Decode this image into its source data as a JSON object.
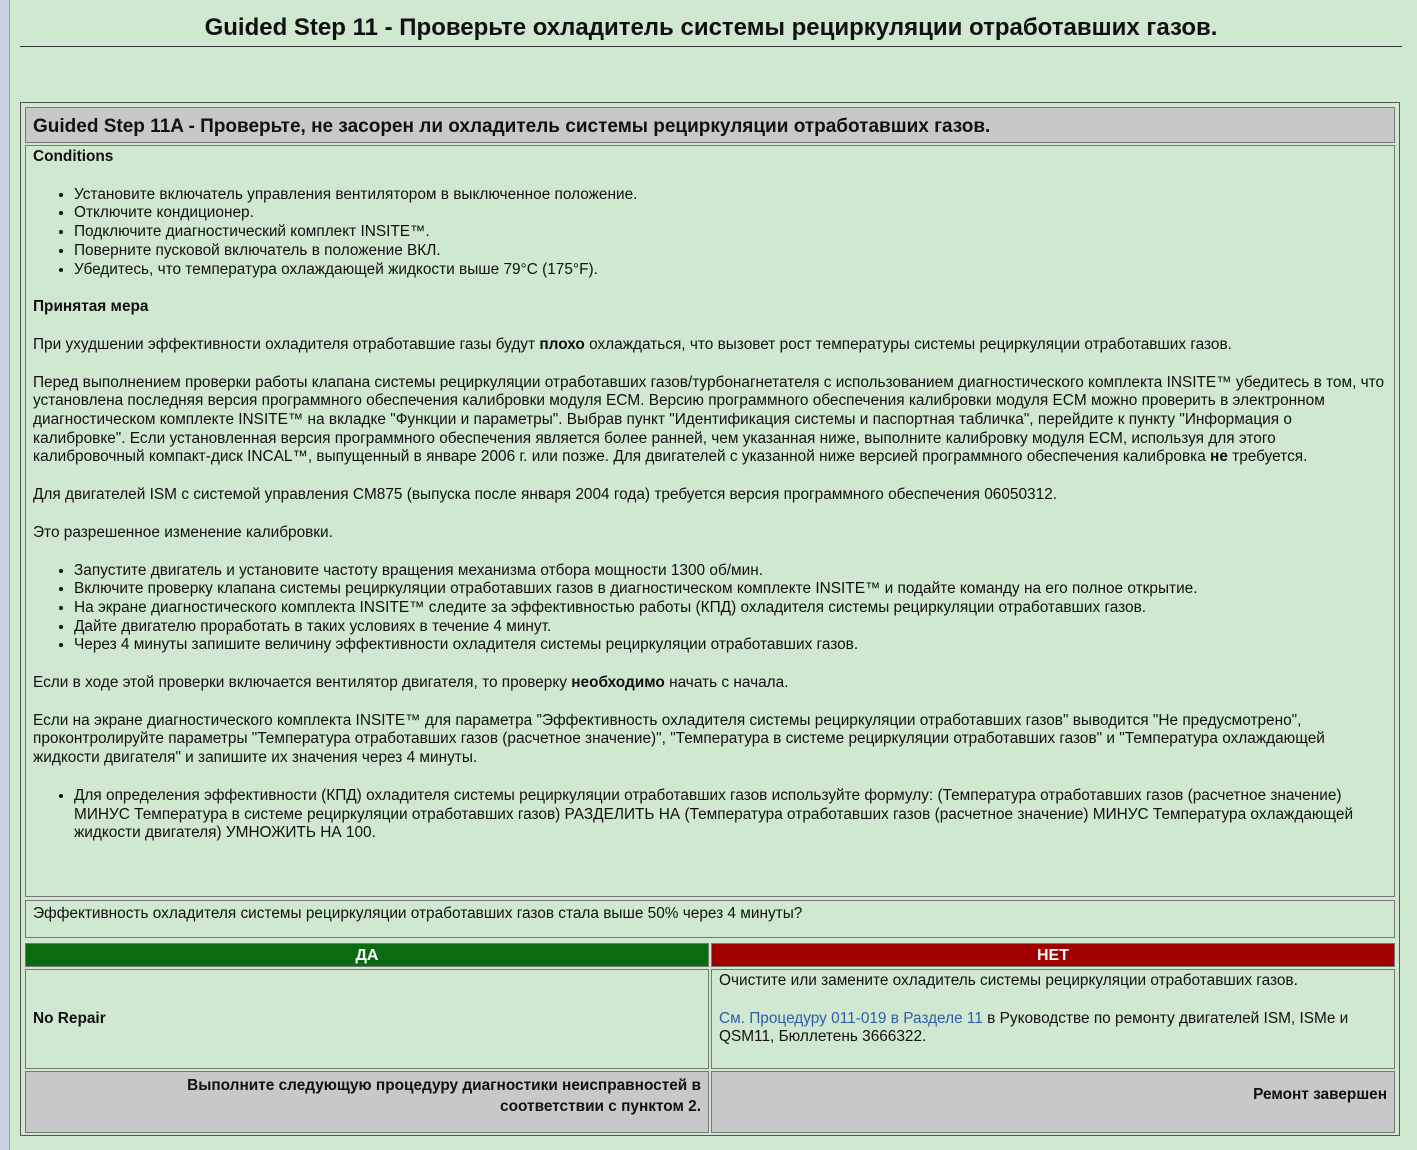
{
  "page": {
    "title": "Guided Step 11 - Проверьте охладитель системы рециркуляции отработавших газов."
  },
  "substep": {
    "title": "Guided Step 11A - Проверьте, не засорен ли охладитель системы рециркуляции отработавших газов."
  },
  "conditions": {
    "label": "Conditions",
    "items": [
      "Установите включатель управления вентилятором в выключенное положение.",
      "Отключите кондиционер.",
      "Подключите диагностический комплект INSITE™.",
      "Поверните пусковой включатель в положение ВКЛ.",
      "Убедитесь, что температура охлаждающей жидкости выше 79°C (175°F)."
    ]
  },
  "action": {
    "label": "Принятая мера",
    "p1_before": "При ухудшении эффективности охладителя отработавшие газы будут ",
    "p1_bold": "плохо",
    "p1_after": " охлаждаться, что вызовет рост температуры системы рециркуляции отработавших газов.",
    "p2_before": "Перед выполнением проверки работы клапана системы рециркуляции отработавших газов/турбонагнетателя с использованием диагностического комплекта INSITE™ убедитесь в том, что установлена последняя версия программного обеспечения калибровки модуля ECM. Версию программного обеспечения калибровки модуля ECM можно проверить в электронном диагностическом комплекте INSITE™ на вкладке \"Функции и параметры\". Выбрав пункт \"Идентификация системы и паспортная табличка\", перейдите к пункту \"Информация о калибровке\". Если установленная версия программного обеспечения является более ранней, чем указанная ниже, выполните калибровку модуля ECM, используя для этого калибровочный компакт-диск INCAL™, выпущенный в январе 2006 г. или позже. Для двигателей с указанной ниже версией программного обеспечения калибровка ",
    "p2_bold": "не",
    "p2_after": " требуется.",
    "p3": "Для двигателей ISM с системой управления CM875 (выпуска после января 2004 года) требуется версия программного обеспечения 06050312.",
    "p4": "Это разрешенное изменение калибровки.",
    "steps": [
      "Запустите двигатель и установите частоту вращения механизма отбора мощности 1300 об/мин.",
      "Включите проверку клапана системы рециркуляции отработавших газов в диагностическом комплекте INSITE™ и подайте команду на его полное открытие.",
      "На экране диагностического комплекта INSITE™ следите за эффективностью работы (КПД) охладителя системы рециркуляции отработавших газов.",
      "Дайте двигателю проработать в таких условиях в течение 4 минут.",
      "Через 4 минуты запишите величину эффективности охладителя системы рециркуляции отработавших газов."
    ],
    "p5_before": "Если в ходе этой проверки включается вентилятор двигателя, то проверку ",
    "p5_bold": "необходимо",
    "p5_after": " начать с начала.",
    "p6": "Если на экране диагностического комплекта INSITE™ для параметра \"Эффективность охладителя системы рециркуляции отработавших газов\" выводится \"Не предусмотрено\", проконтролируйте параметры \"Температура отработавших газов (расчетное значение)\", \"Температура в системе рециркуляции отработавших газов\" и \"Температура охлаждающей жидкости двигателя\" и запишите их значения через 4 минуты.",
    "formula": "Для определения эффективности (КПД) охладителя системы рециркуляции отработавших газов используйте формулу: (Температура отработавших газов (расчетное значение) МИНУС Температура в системе рециркуляции отработавших газов) РАЗДЕЛИТЬ НА (Температура отработавших газов (расчетное значение) МИНУС Температура охлаждающей жидкости двигателя) УМНОЖИТЬ НА 100."
  },
  "question": "Эффективность охладителя системы рециркуляции отработавших газов стала выше 50% через 4 минуты?",
  "yes": {
    "label": "ДА",
    "body": "No Repair",
    "footer": "Выполните следующую процедуру диагностики неисправностей в соответствии с пунктом 2."
  },
  "no": {
    "label": "НЕТ",
    "body1": "Очистите или замените охладитель системы рециркуляции отработавших газов.",
    "link": "См. Процедуру 011-019 в Разделе 11",
    "body2": " в Руководстве по ремонту двигателей ISM, ISMe и QSM11, Бюллетень 3666322.",
    "footer": "Ремонт завершен"
  },
  "colors": {
    "background": "#cfe8cf",
    "header_gray": "#c8c8c8",
    "yes_green": "#0a6b10",
    "no_red": "#a10000",
    "link_blue": "#2e5fa8"
  }
}
